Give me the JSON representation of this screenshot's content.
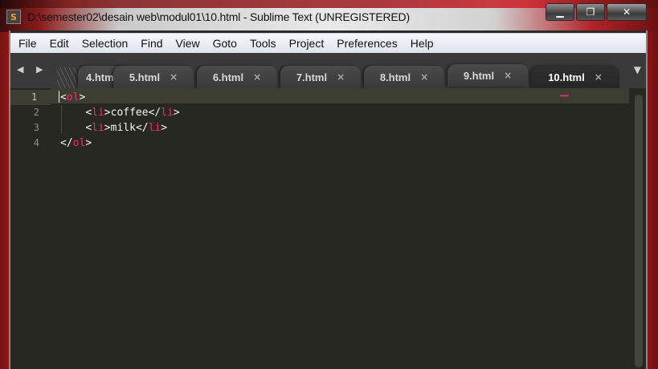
{
  "window": {
    "title": "D:\\semester02\\desain web\\modul01\\10.html - Sublime Text (UNREGISTERED)",
    "app_icon_letter": "S",
    "buttons": {
      "minimize": "▁",
      "maximize": "❐",
      "close": "✕"
    }
  },
  "menu": [
    "File",
    "Edit",
    "Selection",
    "Find",
    "View",
    "Goto",
    "Tools",
    "Project",
    "Preferences",
    "Help"
  ],
  "tabs": [
    {
      "label": "4.htm",
      "close": ""
    },
    {
      "label": "5.html",
      "close": "×"
    },
    {
      "label": "6.html",
      "close": "×"
    },
    {
      "label": "7.html",
      "close": "×"
    },
    {
      "label": "8.html",
      "close": "×"
    },
    {
      "label": "9.html",
      "close": "×"
    },
    {
      "label": "10.html",
      "close": "×",
      "active": true
    }
  ],
  "tab_nav": {
    "arrows": "◀ ▶",
    "overflow": "▼"
  },
  "editor": {
    "line_numbers": [
      "1",
      "2",
      "3",
      "4"
    ],
    "lines": [
      {
        "pre": "",
        "open": "<",
        "tag": "ol",
        "close": ">",
        "text": "",
        "endopen": "",
        "endtag": "",
        "endclose": ""
      },
      {
        "pre": "    ",
        "open": "<",
        "tag": "li",
        "close": ">",
        "text": "coffee",
        "endopen": "</",
        "endtag": "li",
        "endclose": ">"
      },
      {
        "pre": "    ",
        "open": "<",
        "tag": "li",
        "close": ">",
        "text": "milk",
        "endopen": "</",
        "endtag": "li",
        "endclose": ">"
      },
      {
        "pre": "",
        "open": "</",
        "tag": "ol",
        "close": ">",
        "text": "",
        "endopen": "",
        "endtag": "",
        "endclose": ""
      }
    ]
  },
  "colors": {
    "tag": "#f92672",
    "text": "#f8f8f2",
    "background": "#272822"
  }
}
